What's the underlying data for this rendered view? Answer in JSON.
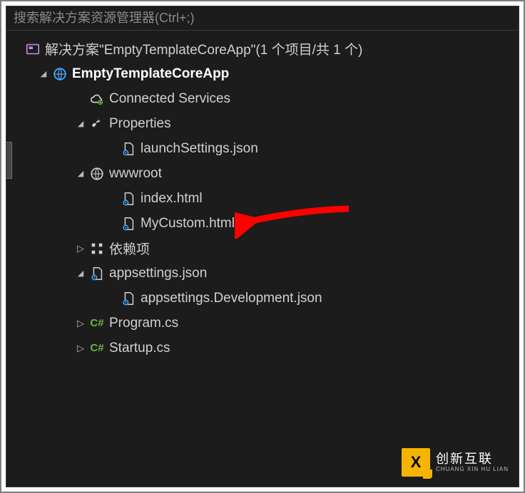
{
  "search": {
    "placeholder": "搜索解决方案资源管理器(Ctrl+;)"
  },
  "solution": {
    "label": "解决方案\"EmptyTemplateCoreApp\"(1 个项目/共 1 个)"
  },
  "project": {
    "label": "EmptyTemplateCoreApp"
  },
  "nodes": {
    "connected_services": "Connected Services",
    "properties": "Properties",
    "launchsettings": "launchSettings.json",
    "wwwroot": "wwwroot",
    "index_html": "index.html",
    "mycustom_html": "MyCustom.html",
    "dependencies": "依赖项",
    "appsettings": "appsettings.json",
    "appsettings_dev": "appsettings.Development.json",
    "program_cs": "Program.cs",
    "startup_cs": "Startup.cs"
  },
  "watermark": {
    "logo_letter": "X",
    "cn": "创新互联",
    "en": "CHUANG XIN HU LIAN"
  }
}
